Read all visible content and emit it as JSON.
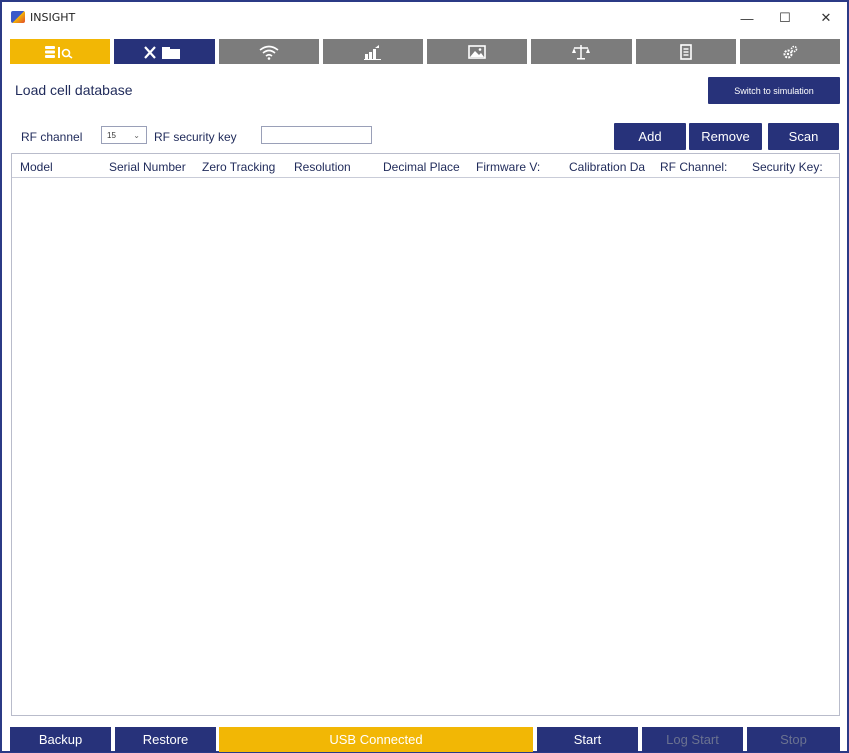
{
  "window": {
    "title": "INSIGHT",
    "controls": {
      "minimize": "—",
      "maximize": "☐",
      "close": "✕"
    }
  },
  "nav": {
    "tabs": [
      {
        "icon": "database-search-icon",
        "glyph": "▮🔍",
        "state": "active"
      },
      {
        "icon": "tools-folder-icon",
        "glyph": "⚒ ▬",
        "state": "secondary"
      },
      {
        "icon": "wireless-icon",
        "glyph": "◠"
      },
      {
        "icon": "chart-up-icon",
        "glyph": "▟"
      },
      {
        "icon": "image-icon",
        "glyph": "▣"
      },
      {
        "icon": "scale-icon",
        "glyph": "⚖"
      },
      {
        "icon": "document-icon",
        "glyph": "▤"
      },
      {
        "icon": "gears-icon",
        "glyph": "⚙"
      }
    ]
  },
  "page": {
    "title": "Load cell database",
    "switch_button": "Switch to simulation"
  },
  "controls": {
    "rf_channel_label": "RF channel",
    "rf_channel_value": "15",
    "rf_security_label": "RF security key",
    "rf_security_value": "",
    "add": "Add",
    "remove": "Remove",
    "scan": "Scan"
  },
  "table": {
    "columns": [
      "Model",
      "Serial Number",
      "Zero Tracking",
      "Resolution",
      "Decimal Place",
      "Firmware V:",
      "Calibration Da",
      "RF Channel:",
      "Security Key:"
    ],
    "rows": []
  },
  "footer": {
    "backup": "Backup",
    "restore": "Restore",
    "status": "USB Connected",
    "start": "Start",
    "log_start": "Log Start",
    "stop": "Stop"
  },
  "colors": {
    "accent_yellow": "#f2b705",
    "navy": "#27327a",
    "gray_tab": "#7c7c7c",
    "window_border": "#2b3a86"
  }
}
